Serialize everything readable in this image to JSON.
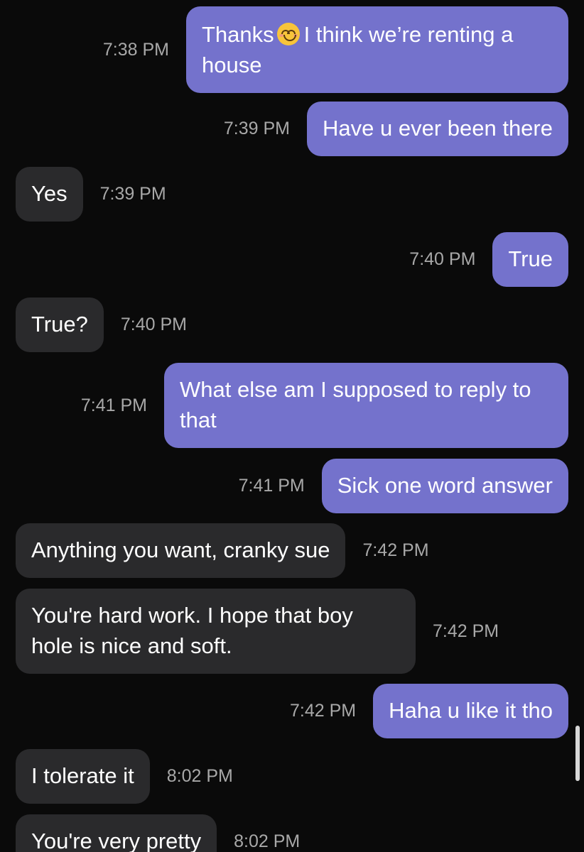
{
  "colors": {
    "outgoing_bubble": "#7472cc",
    "incoming_bubble": "#2a2a2c",
    "background": "#0a0a0a",
    "timestamp": "#a8a8a8"
  },
  "messages": [
    {
      "direction": "out",
      "text_before": "Thanks",
      "emoji": "smiling-face-emoji",
      "text_after": "I think we’re renting a house",
      "time": "7:38 PM"
    },
    {
      "direction": "out",
      "text": "Have u ever been there",
      "time": "7:39 PM"
    },
    {
      "direction": "in",
      "text": "Yes",
      "time": "7:39 PM"
    },
    {
      "direction": "out",
      "text": "True",
      "time": "7:40 PM"
    },
    {
      "direction": "in",
      "text": "True?",
      "time": "7:40 PM"
    },
    {
      "direction": "out",
      "text": "What else am I supposed to reply to that",
      "time": "7:41 PM"
    },
    {
      "direction": "out",
      "text": "Sick one word answer",
      "time": "7:41 PM"
    },
    {
      "direction": "in",
      "text": "Anything you want, cranky sue",
      "time": "7:42 PM"
    },
    {
      "direction": "in",
      "text": "You're hard work. I hope that boy hole is nice and soft.",
      "time": "7:42 PM"
    },
    {
      "direction": "out",
      "text": "Haha u like it tho",
      "time": "7:42 PM"
    },
    {
      "direction": "in",
      "text": "I tolerate it",
      "time": "8:02 PM"
    },
    {
      "direction": "in",
      "text": "You're very pretty",
      "time": "8:02 PM"
    }
  ]
}
